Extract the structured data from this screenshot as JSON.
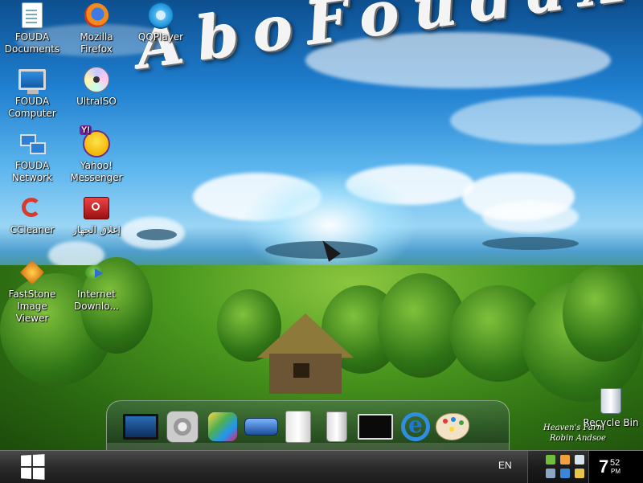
{
  "wallpaper": {
    "title_art": "AboFoudaXp",
    "watermark_line1": "Heaven's Farm",
    "watermark_line2": "Robin Andsoe"
  },
  "desktop_icons": [
    {
      "name": "fouda-documents",
      "label": "FOUDA Documents",
      "icon": "documents-icon"
    },
    {
      "name": "mozilla-firefox",
      "label": "Mozilla Firefox",
      "icon": "firefox-icon"
    },
    {
      "name": "qqplayer",
      "label": "QQPlayer",
      "icon": "qqplayer-icon"
    },
    {
      "name": "fouda-computer",
      "label": "FOUDA Computer",
      "icon": "computer-icon"
    },
    {
      "name": "ultraiso",
      "label": "UltraISO",
      "icon": "disc-icon"
    },
    {
      "name": "fouda-network",
      "label": "FOUDA Network",
      "icon": "network-icon"
    },
    {
      "name": "yahoo-messenger",
      "label": "Yahoo! Messenger",
      "icon": "yahoo-messenger-icon"
    },
    {
      "name": "ccleaner",
      "label": "CCleaner",
      "icon": "ccleaner-icon"
    },
    {
      "name": "shutdown",
      "label": "إغلاق الجهاز",
      "icon": "power-icon"
    },
    {
      "name": "faststone",
      "label": "FastStone Image Viewer",
      "icon": "faststone-icon"
    },
    {
      "name": "internet-download-manager",
      "label": "Internet Downlo...",
      "icon": "download-manager-icon"
    },
    {
      "name": "recycle-bin",
      "label": "Recycle Bin",
      "icon": "recycle-bin-icon"
    }
  ],
  "dock_items": [
    "monitor-icon",
    "settings-icon",
    "photo-gallery-icon",
    "drive-icon",
    "hard-disk-icon",
    "trash-icon",
    "display-icon",
    "internet-explorer-icon",
    "paint-palette-icon"
  ],
  "taskbar": {
    "language": "EN",
    "clock_hour": "7",
    "clock_minute": "52",
    "clock_ampm": "PM"
  }
}
